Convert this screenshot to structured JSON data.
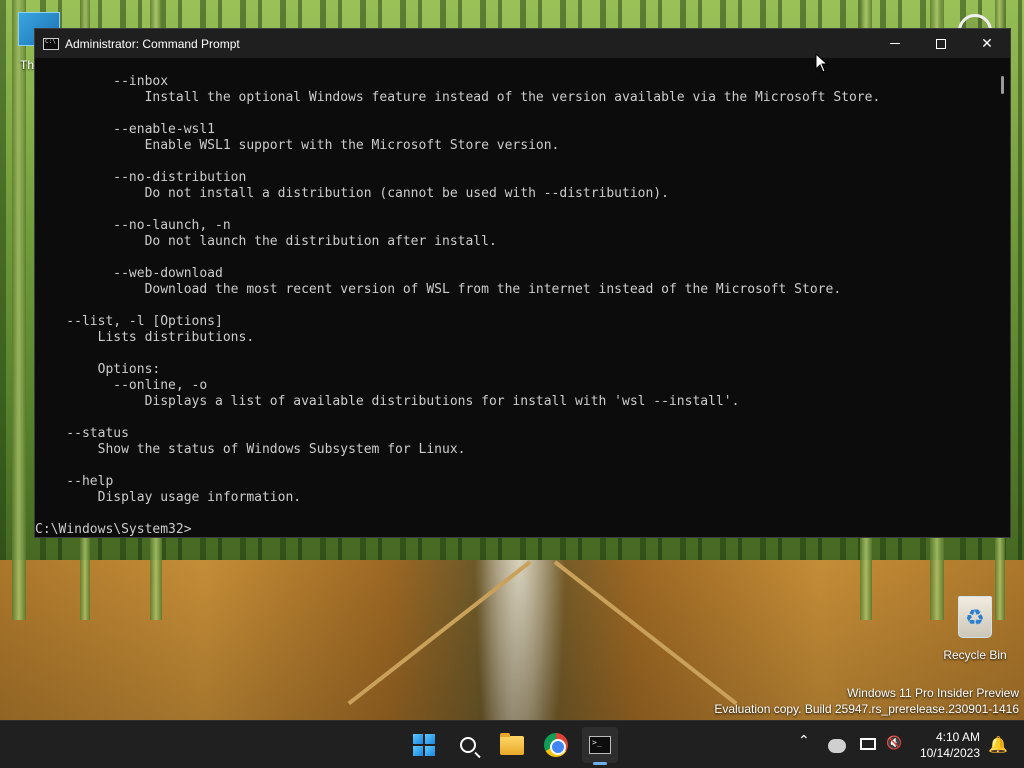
{
  "desktop": {
    "partial_icon_label": "Th",
    "recycle_bin_label": "Recycle Bin",
    "watermark": {
      "line1": "Windows 11 Pro Insider Preview",
      "line2": "Evaluation copy. Build 25947.rs_prerelease.230901-1416"
    }
  },
  "window": {
    "title": "Administrator: Command Prompt",
    "minimize_glyph": "—",
    "maximize_glyph": "☐",
    "close_glyph": "✕",
    "console_lines": [
      "          --inbox",
      "              Install the optional Windows feature instead of the version available via the Microsoft Store.",
      "",
      "          --enable-wsl1",
      "              Enable WSL1 support with the Microsoft Store version.",
      "",
      "          --no-distribution",
      "              Do not install a distribution (cannot be used with --distribution).",
      "",
      "          --no-launch, -n",
      "              Do not launch the distribution after install.",
      "",
      "          --web-download",
      "              Download the most recent version of WSL from the internet instead of the Microsoft Store.",
      "",
      "    --list, -l [Options]",
      "        Lists distributions.",
      "",
      "        Options:",
      "          --online, -o",
      "              Displays a list of available distributions for install with 'wsl --install'.",
      "",
      "    --status",
      "        Show the status of Windows Subsystem for Linux.",
      "",
      "    --help",
      "        Display usage information.",
      ""
    ],
    "prompt": "C:\\Windows\\System32>"
  },
  "taskbar": {
    "apps": [
      "start",
      "search",
      "file-explorer",
      "chrome",
      "command-prompt"
    ],
    "active_app": "command-prompt",
    "tray_chevron": "⌃",
    "time": "4:10 AM",
    "date": "10/14/2023"
  }
}
